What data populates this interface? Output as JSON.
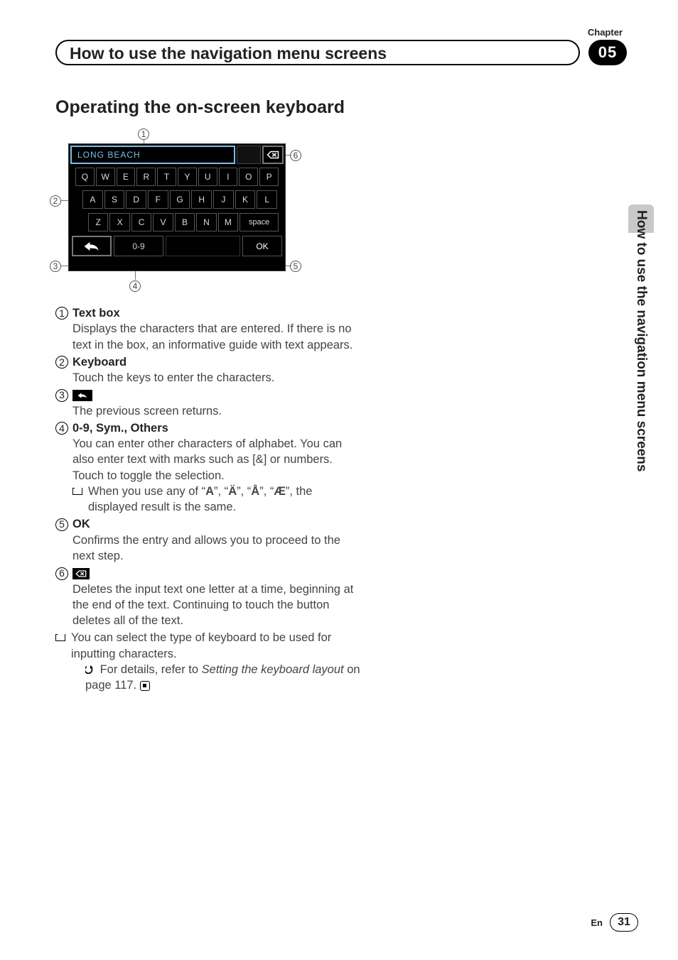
{
  "header": {
    "chapter_label": "Chapter",
    "chapter_number": "05",
    "title": "How to use the navigation menu screens"
  },
  "section_title": "Operating the on-screen keyboard",
  "keyboard": {
    "text_value": "LONG BEACH",
    "row1": [
      "Q",
      "W",
      "E",
      "R",
      "T",
      "Y",
      "U",
      "I",
      "O",
      "P"
    ],
    "row2": [
      "A",
      "S",
      "D",
      "F",
      "G",
      "H",
      "J",
      "K",
      "L"
    ],
    "row3": [
      "Z",
      "X",
      "C",
      "V",
      "B",
      "N",
      "M"
    ],
    "space_label": "space",
    "mode_label": "0-9",
    "ok_label": "OK"
  },
  "callouts": {
    "c1": "1",
    "c2": "2",
    "c3": "3",
    "c4": "4",
    "c5": "5",
    "c6": "6"
  },
  "defs": {
    "d1": {
      "num": "1",
      "title": "Text box",
      "desc": "Displays the characters that are entered. If there is no text in the box, an informative guide with text appears."
    },
    "d2": {
      "num": "2",
      "title": "Keyboard",
      "desc": "Touch the keys to enter the characters."
    },
    "d3": {
      "num": "3",
      "desc": "The previous screen returns."
    },
    "d4": {
      "num": "4",
      "title_a": "0-9",
      "title_sep1": ", ",
      "title_b": "Sym.",
      "title_sep2": ", ",
      "title_c": "Others",
      "desc1": "You can enter other characters of alphabet. You can also enter text with marks such as [&] or numbers.",
      "desc2": "Touch to toggle the selection.",
      "note_a": "When you use any of “",
      "note_b": "”, “",
      "note_c": "”, “",
      "note_d": "”, “",
      "note_e": "”, the displayed result is the same.",
      "ch1": "A",
      "ch2": "Ä",
      "ch3": "Å",
      "ch4": "Æ"
    },
    "d5": {
      "num": "5",
      "title": "OK",
      "desc": "Confirms the entry and allows you to proceed to the next step."
    },
    "d6": {
      "num": "6",
      "desc": "Deletes the input text one letter at a time, beginning at the end of the text. Continuing to touch the button deletes all of the text."
    },
    "tail": {
      "line1": "You can select the type of keyboard to be used for inputting characters.",
      "ref_a": "For details, refer to ",
      "ref_b": "Setting the keyboard layout",
      "ref_c": " on page 117."
    }
  },
  "side_tab": "How to use the navigation menu screens",
  "footer": {
    "lang": "En",
    "page": "31"
  }
}
